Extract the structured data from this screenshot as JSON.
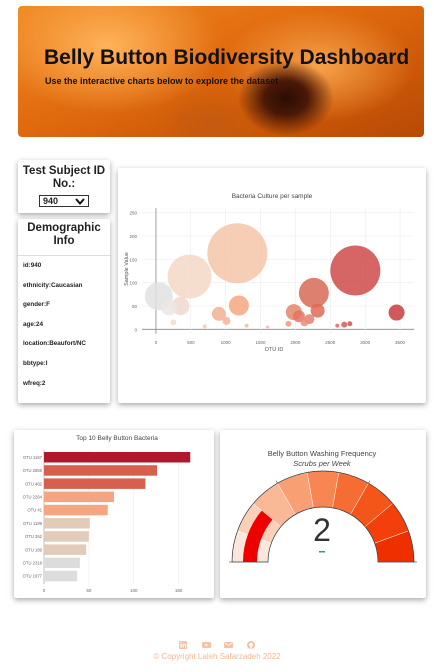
{
  "hero": {
    "title": "Belly Button Biodiversity Dashboard",
    "subtitle": "Use the interactive charts below to explore the dataset"
  },
  "selector": {
    "label": "Test Subject ID No.:",
    "selected": "940",
    "icon": "chevron-down-icon"
  },
  "demographic": {
    "title": "Demographic Info",
    "lines": [
      "id:940",
      "ethnicity:Caucasian",
      "gender:F",
      "age:24",
      "location:Beaufort/NC",
      "bbtype:I",
      "wfreq:2"
    ]
  },
  "bubble_chart": {
    "title": "Bacteria Culture per sample",
    "xlabel": "OTU ID",
    "ylabel": "Sample Value",
    "x_ticks": [
      "0",
      "500",
      "1000",
      "1500",
      "2000",
      "2500",
      "3000",
      "3500"
    ],
    "y_ticks": [
      "0",
      "50",
      "100",
      "150",
      "200",
      "250"
    ]
  },
  "bar_chart": {
    "title": "Top 10 Belly Button Bacteria",
    "x_ticks": [
      "0",
      "50",
      "100",
      "150"
    ]
  },
  "gauge": {
    "title": "Belly Button Washing Frequency",
    "subtitle": "Scrubs per Week",
    "value_text": "2"
  },
  "footer": {
    "icons": [
      "linkedin-icon",
      "youtube-icon",
      "mail-icon",
      "github-icon"
    ],
    "copyright": "© Copyright Laleh Safarzadeh 2022"
  },
  "chart_data": [
    {
      "type": "scatter",
      "title": "Bacteria Culture per sample",
      "xlabel": "OTU ID",
      "ylabel": "Sample Value",
      "xlim": [
        -200,
        3700
      ],
      "ylim": [
        -10,
        260
      ],
      "grid": true,
      "points": [
        {
          "x": 1167,
          "y": 163,
          "r": 30,
          "color": "#f4c6a8"
        },
        {
          "x": 2859,
          "y": 126,
          "r": 25,
          "color": "#cf4a4a"
        },
        {
          "x": 482,
          "y": 113,
          "r": 22,
          "color": "#f3d8c4"
        },
        {
          "x": 2264,
          "y": 78,
          "r": 15,
          "color": "#d86a55"
        },
        {
          "x": 41,
          "y": 71,
          "r": 14,
          "color": "#e2e2e2"
        },
        {
          "x": 1189,
          "y": 51,
          "r": 10,
          "color": "#f3a77f"
        },
        {
          "x": 352,
          "y": 50,
          "r": 9,
          "color": "#efd8cc"
        },
        {
          "x": 189,
          "y": 47,
          "r": 8,
          "color": "#ece6e3"
        },
        {
          "x": 2318,
          "y": 40,
          "r": 7,
          "color": "#e06a55"
        },
        {
          "x": 1977,
          "y": 37,
          "r": 8,
          "color": "#e2866a"
        },
        {
          "x": 3450,
          "y": 36,
          "r": 8,
          "color": "#c83c3c"
        },
        {
          "x": 902,
          "y": 33,
          "r": 7,
          "color": "#f2b090"
        },
        {
          "x": 2050,
          "y": 28,
          "r": 6,
          "color": "#e57360"
        },
        {
          "x": 2200,
          "y": 22,
          "r": 5,
          "color": "#e28070"
        },
        {
          "x": 2130,
          "y": 15,
          "r": 4,
          "color": "#ea8c77"
        },
        {
          "x": 1010,
          "y": 18,
          "r": 4,
          "color": "#f4b496"
        },
        {
          "x": 1900,
          "y": 12,
          "r": 3,
          "color": "#eb9b85"
        },
        {
          "x": 2700,
          "y": 10,
          "r": 3,
          "color": "#d85a55"
        },
        {
          "x": 2780,
          "y": 12,
          "r": 2.5,
          "color": "#d45050"
        },
        {
          "x": 2600,
          "y": 8,
          "r": 2,
          "color": "#dd6a66"
        },
        {
          "x": 250,
          "y": 15,
          "r": 3,
          "color": "#f0ddd0"
        },
        {
          "x": 1300,
          "y": 8,
          "r": 2,
          "color": "#f3bf9f"
        },
        {
          "x": 700,
          "y": 6,
          "r": 2,
          "color": "#f2c8ac"
        },
        {
          "x": 1600,
          "y": 5,
          "r": 1.5,
          "color": "#f0b59a"
        }
      ]
    },
    {
      "type": "bar",
      "orientation": "horizontal",
      "title": "Top 10 Belly Button Bacteria",
      "categories": [
        "OTU 1167",
        "OTU 2859",
        "OTU 482",
        "OTU 2264",
        "OTU 41",
        "OTU 1189",
        "OTU 352",
        "OTU 189",
        "OTU 2318",
        "OTU 1977"
      ],
      "values": [
        163,
        126,
        113,
        78,
        71,
        51,
        50,
        47,
        40,
        37
      ],
      "colors": [
        "#b2182b",
        "#d6604d",
        "#d6604d",
        "#f4a582",
        "#f4a582",
        "#e2cbb8",
        "#e2cbb8",
        "#e2cbb8",
        "#dcdcdc",
        "#dcdcdc"
      ],
      "xlim": [
        0,
        175
      ],
      "xticks": [
        0,
        50,
        100,
        150
      ]
    },
    {
      "type": "gauge",
      "title": "Belly Button Washing Frequency",
      "subtitle": "Scrubs per Week",
      "value": 2,
      "range": [
        0,
        9
      ],
      "steps": [
        "#f9e7dc",
        "#fad1b8",
        "#f9b896",
        "#f89f74",
        "#f78653",
        "#f66d34",
        "#f4561a",
        "#f23f0c",
        "#ef2f00"
      ]
    }
  ]
}
